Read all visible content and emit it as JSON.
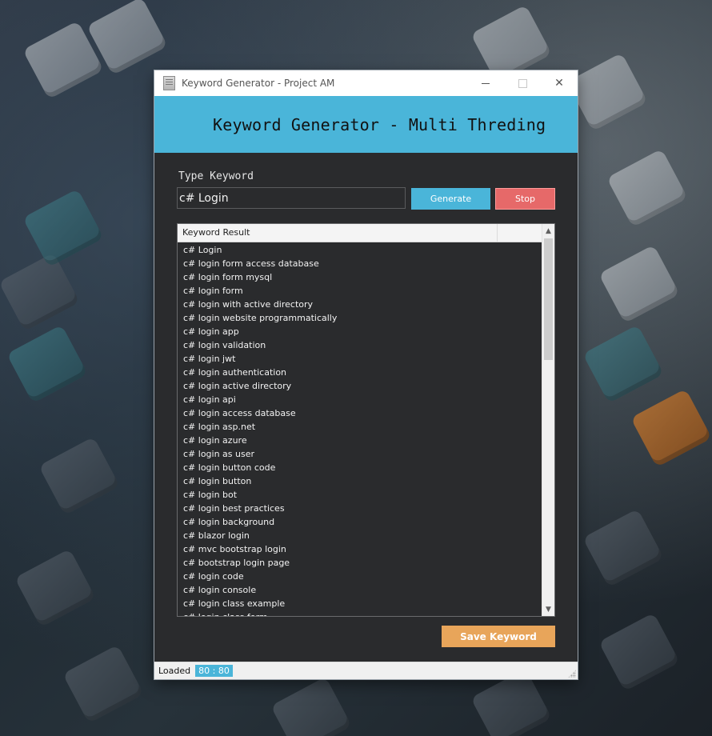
{
  "window": {
    "title": "Keyword Generator - Project AM",
    "controls": {
      "minimize": "—",
      "maximize": "",
      "close": "✕"
    }
  },
  "header": {
    "title": "Keyword Generator - Multi Threding"
  },
  "form": {
    "type_label": "Type Keyword",
    "keyword_value": "c# Login",
    "generate_label": "Generate",
    "stop_label": "Stop"
  },
  "results": {
    "column_header": "Keyword Result",
    "items": [
      "c# Login",
      "c# login form access database",
      "c# login form mysql",
      "c# login form",
      "c# login with active directory",
      "c# login website programmatically",
      "c# login app",
      "c# login validation",
      "c# login jwt",
      "c# login authentication",
      "c# login active directory",
      "c# login api",
      "c# login access database",
      "c# login asp.net",
      "c# login azure",
      "c# login as user",
      "c# login button code",
      "c# login button",
      "c# login bot",
      "c# login best practices",
      "c# login background",
      "c# blazor login",
      "c# mvc bootstrap login",
      "c# bootstrap login page",
      "c# login code",
      "c# login console",
      "c# login class example",
      "c# login class form"
    ]
  },
  "save_label": "Save Keyword",
  "status": {
    "label": "Loaded",
    "count": "80 : 80"
  },
  "colors": {
    "accent": "#4ab5d9",
    "stop": "#e66969",
    "save": "#e8a55a",
    "panel": "#2a2b2d"
  }
}
